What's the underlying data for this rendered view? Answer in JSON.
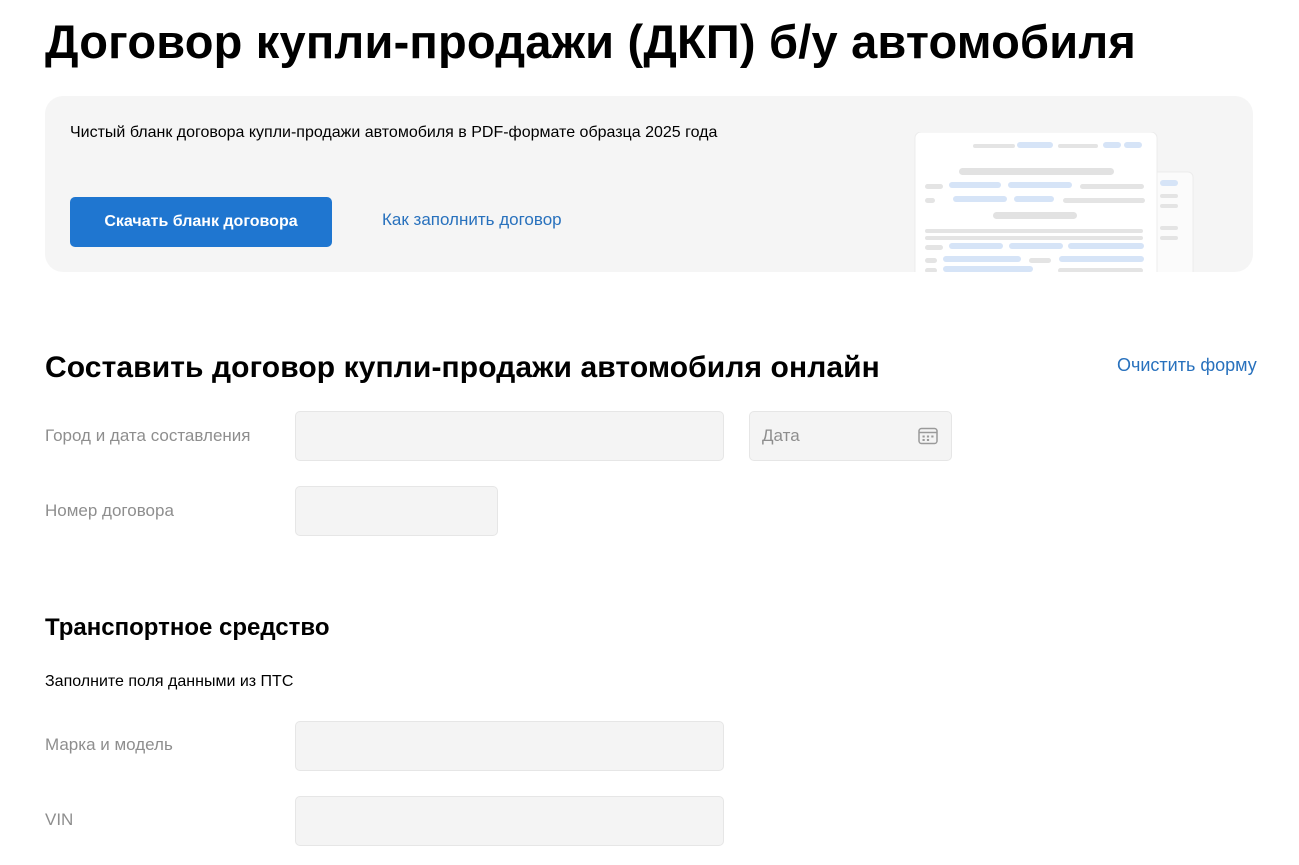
{
  "title": "Договор купли-продажи (ДКП) б/у автомобиля",
  "banner": {
    "text": "Чистый бланк договора купли-продажи автомобиля в PDF-формате образца 2025 года",
    "download_label": "Скачать бланк договора",
    "howto_label": "Как заполнить договор",
    "illustration_icon": "document-preview-illustration"
  },
  "form": {
    "title": "Составить договор купли-продажи автомобиля онлайн",
    "clear_label": "Очистить форму",
    "city_label": "Город и дата составления",
    "city_value": "",
    "date_placeholder": "Дата",
    "date_icon": "calendar-icon",
    "number_label": "Номер договора",
    "number_value": ""
  },
  "vehicle": {
    "title": "Транспортное средство",
    "hint": "Заполните поля данными из ПТС",
    "model_label": "Марка и модель",
    "model_value": "",
    "vin_label": "VIN",
    "vin_value": ""
  },
  "colors": {
    "primary": "#1f76d0",
    "link": "#2871bd",
    "banner_bg": "#f5f5f5",
    "field_bg": "#f4f4f4",
    "label": "#8e8e8e"
  }
}
